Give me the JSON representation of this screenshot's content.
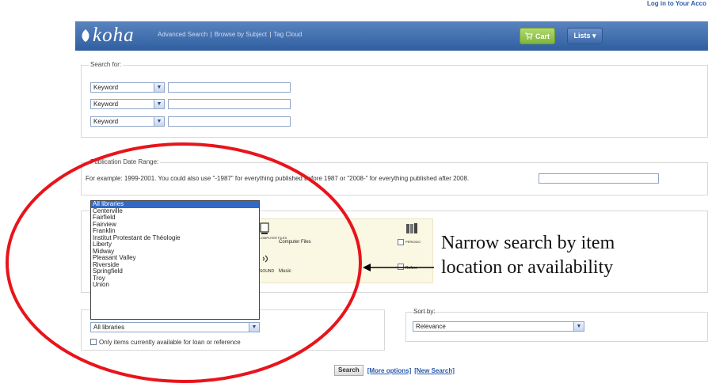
{
  "topbar": {
    "login_link": "Log in to Your Acco"
  },
  "header": {
    "logo_text": "koha",
    "nav": [
      "Advanced Search",
      "Browse by Subject",
      "Tag Cloud"
    ],
    "nav_sep": "|",
    "cart_label": "Cart",
    "lists_label": "Lists ▾"
  },
  "search_for": {
    "legend": "Search for:",
    "rows": [
      {
        "index": "Keyword",
        "value": ""
      },
      {
        "index": "Keyword",
        "value": ""
      },
      {
        "index": "Keyword",
        "value": ""
      }
    ]
  },
  "pub_date": {
    "legend": "Publication Date Range:",
    "example": "For example: 1999-2001. You could also use \"-1987\" for everything published before 1987 or \"2008-\" for everything published after 2008.",
    "value": ""
  },
  "library_dropdown": {
    "options": [
      "All libraries",
      "Centerville",
      "Fairfield",
      "Fairview",
      "Franklin",
      "Institut Protestant de Théologie",
      "Liberty",
      "Midway",
      "Pleasant Valley",
      "Riverside",
      "Springfield",
      "Troy",
      "Union"
    ],
    "selected": "All libraries"
  },
  "item_types": {
    "computer_label": "COMPUTER FILES",
    "computer_files": "Computer Files",
    "sound_label": "SOUND",
    "music": "Music",
    "periodicals_label": "PERIODIC",
    "reference_label": "Refere"
  },
  "availability": {
    "only_available": "Only items currently available for loan or reference"
  },
  "sort": {
    "legend": "Sort by:",
    "selected": "Relevance"
  },
  "actions": {
    "search": "Search",
    "more_options": "[More options]",
    "new_search": "[New Search]"
  },
  "annotation": {
    "line1": "Narrow search by item",
    "line2": "location or availability"
  },
  "colors": {
    "header": "#3a69a8",
    "cart": "#8dc04a",
    "annotation_ring": "#e8141b"
  }
}
